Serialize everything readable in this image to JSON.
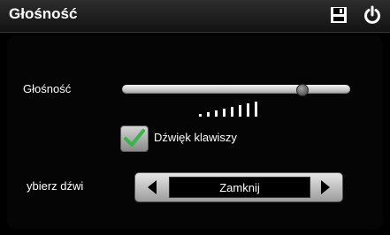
{
  "header": {
    "title": "Głośność",
    "icons": [
      "save-icon",
      "power-icon"
    ]
  },
  "volume": {
    "label": "Głośność",
    "level": 0.79
  },
  "key_sound": {
    "label": "Dźwięk klawiszy",
    "checked": true
  },
  "sound_select": {
    "label": "ybierz dźwi",
    "value": "Zamknij"
  },
  "colors": {
    "background": "#000000",
    "header": "#1e1e1e",
    "check": "#39b54a"
  }
}
